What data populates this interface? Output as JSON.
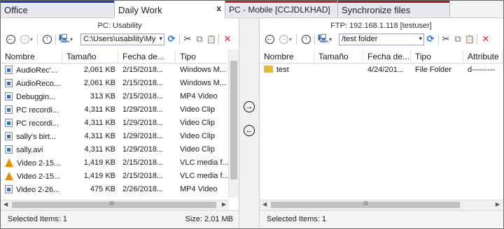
{
  "tabs": [
    {
      "label": "Office",
      "accent": "#1f3fb8",
      "active": false
    },
    {
      "label": "Daily Work",
      "accent": "#ffffff",
      "active": true,
      "close": "x"
    },
    {
      "label": "PC - Mobile [CCJDLKHAD]",
      "accent": "#c0282d",
      "active": false
    },
    {
      "label": "Synchronize files",
      "accent": "#a51d24",
      "active": false
    }
  ],
  "left": {
    "title": "PC: Usability",
    "path": "C:\\Users\\usability\\My",
    "columns": [
      "Nombre",
      "Tamaño",
      "Fecha de...",
      "Tipo"
    ],
    "rows": [
      {
        "icon": "doc",
        "name": "AudioRec'...",
        "size": "2,061 KB",
        "date": "2/15/2018...",
        "type": "Windows M..."
      },
      {
        "icon": "doc",
        "name": "AudioReco...",
        "size": "2,061 KB",
        "date": "2/15/2018...",
        "type": "Windows M..."
      },
      {
        "icon": "doc",
        "name": "Debuggin...",
        "size": "313 KB",
        "date": "2/15/2018...",
        "type": "MP4 Video"
      },
      {
        "icon": "doc",
        "name": "PC recordi...",
        "size": "4,311 KB",
        "date": "1/29/2018...",
        "type": "Video Clip"
      },
      {
        "icon": "doc",
        "name": "PC recordi...",
        "size": "4,311 KB",
        "date": "1/29/2018...",
        "type": "Video Clip"
      },
      {
        "icon": "doc",
        "name": "sally's birt...",
        "size": "4,311 KB",
        "date": "1/29/2018...",
        "type": "Video Clip"
      },
      {
        "icon": "doc",
        "name": "sally.avi",
        "size": "4,311 KB",
        "date": "1/29/2018...",
        "type": "Video Clip"
      },
      {
        "icon": "cone",
        "name": "Video 2-15...",
        "size": "1,419 KB",
        "date": "2/15/2018...",
        "type": "VLC media f..."
      },
      {
        "icon": "cone",
        "name": "Video 2-15...",
        "size": "1,419 KB",
        "date": "2/15/2018...",
        "type": "VLC media f..."
      },
      {
        "icon": "doc",
        "name": "Video 2-26...",
        "size": "475 KB",
        "date": "2/26/2018...",
        "type": "MP4 Video"
      }
    ],
    "scroll_dots": "III",
    "status_left": "Selected Items: 1",
    "status_right": "Size: 2.01 MB"
  },
  "right": {
    "title": "FTP: 192.168.1.118 [testuser]",
    "path": "/test folder",
    "columns": [
      "Nombre",
      "Tamaño",
      "Fecha de...",
      "Tipo",
      "Attribute"
    ],
    "rows": [
      {
        "icon": "folder",
        "name": "test",
        "size": "",
        "date": "4/24/201...",
        "type": "File Folder",
        "attr": "d---------"
      }
    ],
    "scroll_dots": "III",
    "status_left": "Selected Items: 1"
  },
  "transfer": {
    "to_right": "→",
    "to_left": "←"
  },
  "colors": {
    "refresh": "#1e73d8",
    "delete": "#e0262e"
  },
  "icons": {
    "back": "←",
    "forward": "→",
    "up": "↑",
    "computer": "🖳",
    "dropdown": "▾",
    "refresh": "⟳",
    "cut": "✂",
    "copy": "⧉",
    "paste": "📋",
    "delete": "✕"
  }
}
